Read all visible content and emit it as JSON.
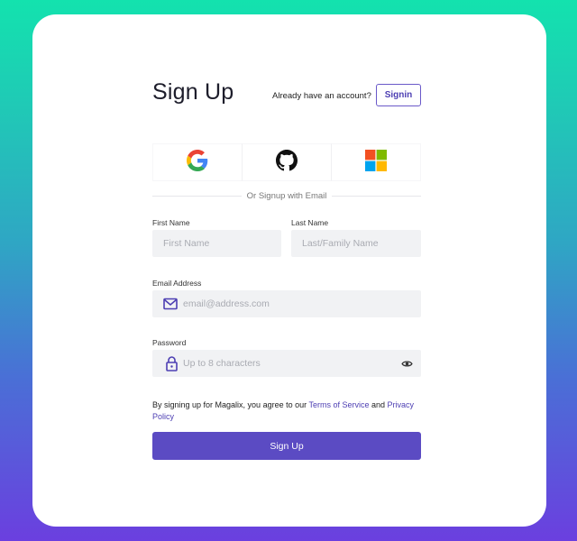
{
  "header": {
    "title": "Sign Up",
    "have_account_text": "Already have an account?",
    "signin_label": "Signin"
  },
  "social": {
    "providers": [
      "google",
      "github",
      "microsoft"
    ]
  },
  "divider_text": "Or Signup with Email",
  "form": {
    "first_name": {
      "label": "First Name",
      "placeholder": "First Name",
      "value": ""
    },
    "last_name": {
      "label": "Last Name",
      "placeholder": "Last/Family Name",
      "value": ""
    },
    "email": {
      "label": "Email Address",
      "placeholder": "email@address.com",
      "value": ""
    },
    "password": {
      "label": "Password",
      "placeholder": "Up to 8 characters",
      "value": ""
    }
  },
  "terms": {
    "prefix": "By signing up for Magalix, you agree to our",
    "tos_link": "Terms of Service",
    "and": "and",
    "privacy_link": "Privacy Policy"
  },
  "submit_label": "Sign Up",
  "colors": {
    "accent": "#5b4bc3",
    "input_bg": "#f1f2f4",
    "gradient_top": "#13e2ae",
    "gradient_bottom": "#6b3fdf"
  }
}
